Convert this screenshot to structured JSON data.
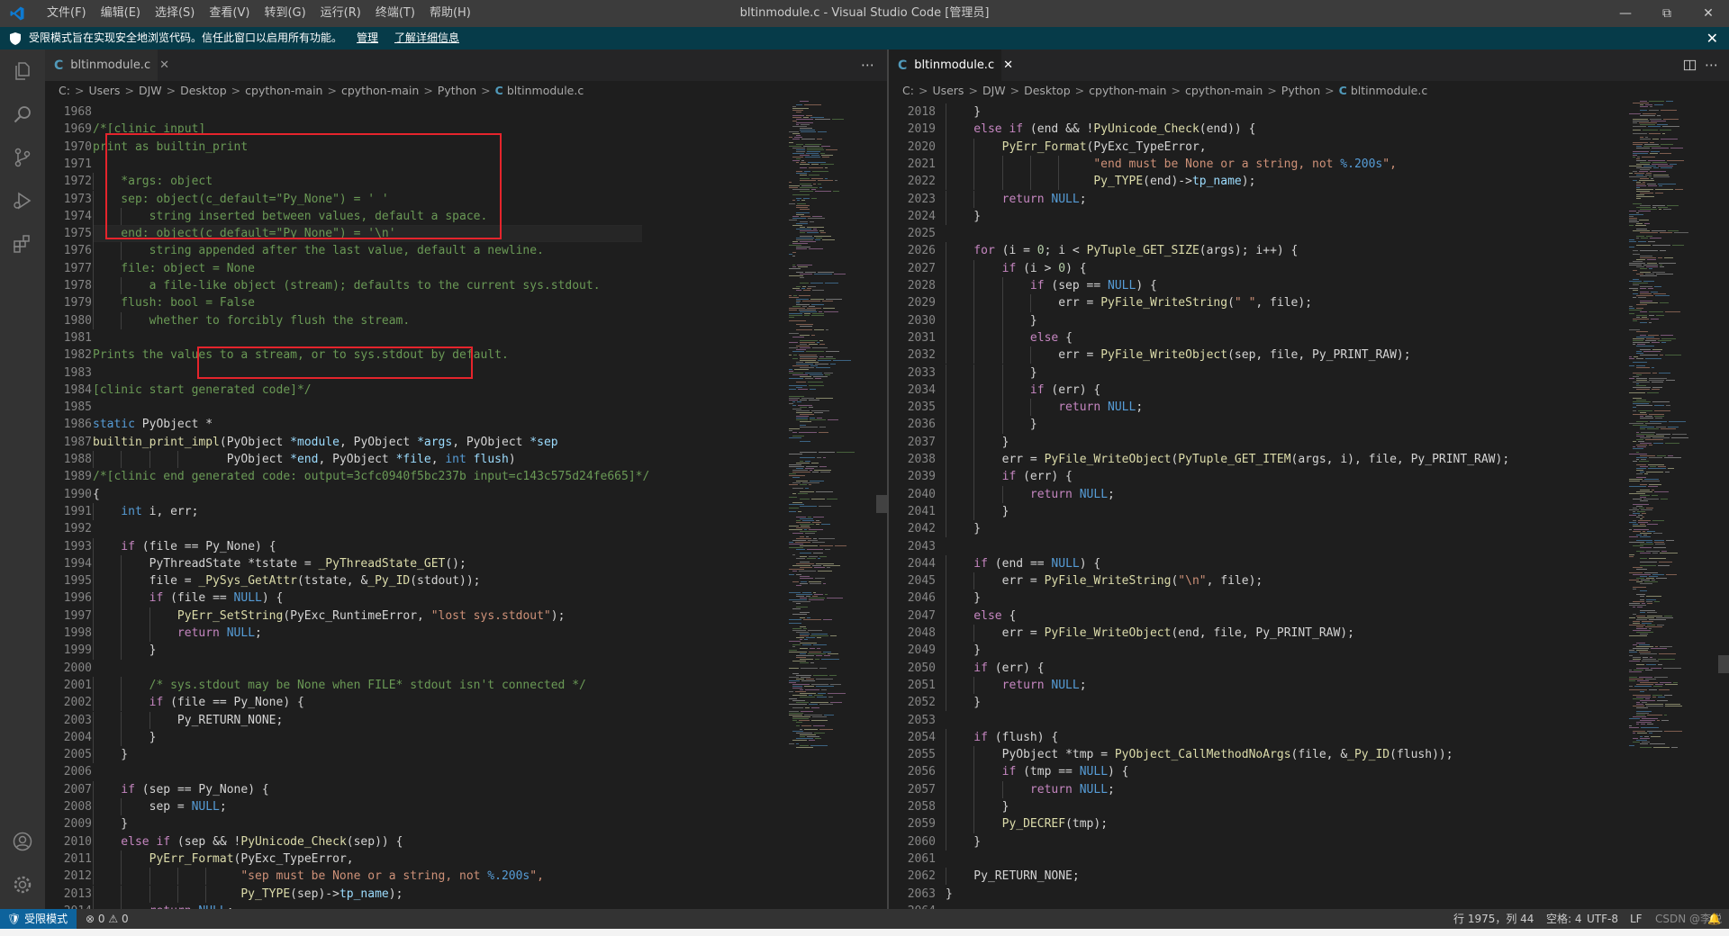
{
  "titlebar": {
    "menus": [
      "文件(F)",
      "编辑(E)",
      "选择(S)",
      "查看(V)",
      "转到(G)",
      "运行(R)",
      "终端(T)",
      "帮助(H)"
    ],
    "title": "bltinmodule.c - Visual Studio Code [管理员]"
  },
  "banner": {
    "message": "受限模式旨在实现安全地浏览代码。信任此窗口以启用所有功能。",
    "manage_link": "管理",
    "learn_link": "了解详细信息"
  },
  "activity": [
    "explorer-icon",
    "search-icon",
    "source-control-icon",
    "run-debug-icon",
    "extensions-icon",
    "accounts-icon",
    "settings-gear-icon"
  ],
  "editors": {
    "left": {
      "tab": "bltinmodule.c",
      "breadcrumb": [
        "C:",
        "Users",
        "DJW",
        "Desktop",
        "cpython-main",
        "cpython-main",
        "Python",
        "bltinmodule.c"
      ],
      "first_line": 1968,
      "lines": [
        [],
        [
          [
            "/*[clinic input]",
            "c"
          ]
        ],
        [
          [
            "print as builtin_print",
            "c"
          ]
        ],
        [],
        [
          [
            "    *args: object",
            "c"
          ]
        ],
        [
          [
            "    sep: object(c_default=\"Py_None\") = ' '",
            "c"
          ]
        ],
        [
          [
            "        string inserted between values, default a space.",
            "c"
          ]
        ],
        [
          [
            "    end: object(c_default=\"Py_None\") = '\\n'",
            "c"
          ]
        ],
        [
          [
            "        string appended after the last value, default a newline.",
            "c"
          ]
        ],
        [
          [
            "    file: object = None",
            "c"
          ]
        ],
        [
          [
            "        a file-like object (stream); defaults to the current sys.stdout.",
            "c"
          ]
        ],
        [
          [
            "    flush: bool = False",
            "c"
          ]
        ],
        [
          [
            "        whether to forcibly flush the stream.",
            "c"
          ]
        ],
        [],
        [
          [
            "Prints the values to a stream, or to sys.stdout by default.",
            "c"
          ]
        ],
        [],
        [
          [
            "[clinic start generated code]*/",
            "c"
          ]
        ],
        [],
        [
          [
            "static ",
            "k"
          ],
          [
            "PyObject ",
            "i"
          ],
          [
            "*",
            "o"
          ]
        ],
        [
          [
            "builtin_print_impl",
            "f"
          ],
          [
            "(PyObject ",
            "i"
          ],
          [
            "*module",
            "v"
          ],
          [
            ", PyObject ",
            "i"
          ],
          [
            "*args",
            "v"
          ],
          [
            ", PyObject ",
            "i"
          ],
          [
            "*sep",
            "v"
          ]
        ],
        [
          [
            "                   PyObject ",
            "i"
          ],
          [
            "*end",
            "v"
          ],
          [
            ", PyObject ",
            "i"
          ],
          [
            "*file",
            "v"
          ],
          [
            ", ",
            "i"
          ],
          [
            "int ",
            "k"
          ],
          [
            "flush",
            "v"
          ],
          [
            ")",
            "i"
          ]
        ],
        [
          [
            "/*[clinic end generated code: output=3cfc0940f5bc237b input=c143c575d24fe665]*/",
            "c"
          ]
        ],
        [
          [
            "{",
            "i"
          ]
        ],
        [
          [
            "    int ",
            "k"
          ],
          [
            "i, err;",
            "i"
          ]
        ],
        [],
        [
          [
            "    if ",
            "t"
          ],
          [
            "(file ",
            "i"
          ],
          [
            "== ",
            "o"
          ],
          [
            "Py_None) {",
            "i"
          ]
        ],
        [
          [
            "        PyThreadState ",
            "i"
          ],
          [
            "*",
            "o"
          ],
          [
            "tstate ",
            "i"
          ],
          [
            "= ",
            "o"
          ],
          [
            "_PyThreadState_GET",
            "f"
          ],
          [
            "();",
            "i"
          ]
        ],
        [
          [
            "        file ",
            "i"
          ],
          [
            "= ",
            "o"
          ],
          [
            "_PySys_GetAttr",
            "f"
          ],
          [
            "(tstate, ",
            "i"
          ],
          [
            "&",
            "o"
          ],
          [
            "_Py_ID",
            "f"
          ],
          [
            "(stdout));",
            "i"
          ]
        ],
        [
          [
            "        if ",
            "t"
          ],
          [
            "(file ",
            "i"
          ],
          [
            "== ",
            "o"
          ],
          [
            "NULL",
            "k"
          ],
          [
            ") {",
            "i"
          ]
        ],
        [
          [
            "            PyErr_SetString",
            "f"
          ],
          [
            "(PyExc_RuntimeError, ",
            "i"
          ],
          [
            "\"lost sys.stdout\"",
            "s"
          ],
          [
            ");",
            "i"
          ]
        ],
        [
          [
            "            return ",
            "t"
          ],
          [
            "NULL",
            "k"
          ],
          [
            ";",
            "i"
          ]
        ],
        [
          [
            "        }",
            "i"
          ]
        ],
        [],
        [
          [
            "        /* sys.stdout may be None when FILE* stdout isn't connected */",
            "c"
          ]
        ],
        [
          [
            "        if ",
            "t"
          ],
          [
            "(file ",
            "i"
          ],
          [
            "== ",
            "o"
          ],
          [
            "Py_None) {",
            "i"
          ]
        ],
        [
          [
            "            Py_RETURN_NONE;",
            "i"
          ]
        ],
        [
          [
            "        }",
            "i"
          ]
        ],
        [
          [
            "    }",
            "i"
          ]
        ],
        [],
        [
          [
            "    if ",
            "t"
          ],
          [
            "(sep ",
            "i"
          ],
          [
            "== ",
            "o"
          ],
          [
            "Py_None) {",
            "i"
          ]
        ],
        [
          [
            "        sep ",
            "i"
          ],
          [
            "= ",
            "o"
          ],
          [
            "NULL",
            "k"
          ],
          [
            ";",
            "i"
          ]
        ],
        [
          [
            "    }",
            "i"
          ]
        ],
        [
          [
            "    else if ",
            "t"
          ],
          [
            "(sep ",
            "i"
          ],
          [
            "&& !",
            "o"
          ],
          [
            "PyUnicode_Check",
            "f"
          ],
          [
            "(sep)) {",
            "i"
          ]
        ],
        [
          [
            "        PyErr_Format",
            "f"
          ],
          [
            "(PyExc_TypeError,",
            "i"
          ]
        ],
        [
          [
            "                     \"sep must be None or a string, not ",
            "s"
          ],
          [
            "%.200s",
            "k"
          ],
          [
            "\",",
            "s"
          ]
        ],
        [
          [
            "                     Py_TYPE",
            "f"
          ],
          [
            "(sep)->",
            "i"
          ],
          [
            "tp_name",
            "v"
          ],
          [
            ");",
            "i"
          ]
        ],
        [
          [
            "        return ",
            "t"
          ],
          [
            "NULL",
            "k"
          ],
          [
            ";",
            "i"
          ]
        ]
      ]
    },
    "right": {
      "tab": "bltinmodule.c",
      "breadcrumb": [
        "C:",
        "Users",
        "DJW",
        "Desktop",
        "cpython-main",
        "cpython-main",
        "Python",
        "bltinmodule.c"
      ],
      "first_line": 2018,
      "lines": [
        [
          [
            "    }",
            "i"
          ]
        ],
        [
          [
            "    else if ",
            "t"
          ],
          [
            "(end ",
            "i"
          ],
          [
            "&& !",
            "o"
          ],
          [
            "PyUnicode_Check",
            "f"
          ],
          [
            "(end)) {",
            "i"
          ]
        ],
        [
          [
            "        PyErr_Format",
            "f"
          ],
          [
            "(PyExc_TypeError,",
            "i"
          ]
        ],
        [
          [
            "                     \"end must be None or a string, not ",
            "s"
          ],
          [
            "%.200s",
            "k"
          ],
          [
            "\",",
            "s"
          ]
        ],
        [
          [
            "                     Py_TYPE",
            "f"
          ],
          [
            "(end)->",
            "i"
          ],
          [
            "tp_name",
            "v"
          ],
          [
            ");",
            "i"
          ]
        ],
        [
          [
            "        return ",
            "t"
          ],
          [
            "NULL",
            "k"
          ],
          [
            ";",
            "i"
          ]
        ],
        [
          [
            "    }",
            "i"
          ]
        ],
        [],
        [
          [
            "    for ",
            "t"
          ],
          [
            "(i ",
            "i"
          ],
          [
            "= ",
            "o"
          ],
          [
            "0",
            "n"
          ],
          [
            "; i ",
            "i"
          ],
          [
            "< ",
            "o"
          ],
          [
            "PyTuple_GET_SIZE",
            "f"
          ],
          [
            "(args); i",
            "i"
          ],
          [
            "++",
            "o"
          ],
          [
            ") {",
            "i"
          ]
        ],
        [
          [
            "        if ",
            "t"
          ],
          [
            "(i ",
            "i"
          ],
          [
            "> ",
            "o"
          ],
          [
            "0",
            "n"
          ],
          [
            ") {",
            "i"
          ]
        ],
        [
          [
            "            if ",
            "t"
          ],
          [
            "(sep ",
            "i"
          ],
          [
            "== ",
            "o"
          ],
          [
            "NULL",
            "k"
          ],
          [
            ") {",
            "i"
          ]
        ],
        [
          [
            "                err ",
            "i"
          ],
          [
            "= ",
            "o"
          ],
          [
            "PyFile_WriteString",
            "f"
          ],
          [
            "(",
            "i"
          ],
          [
            "\" \"",
            "s"
          ],
          [
            ", file);",
            "i"
          ]
        ],
        [
          [
            "            }",
            "i"
          ]
        ],
        [
          [
            "            else ",
            "t"
          ],
          [
            "{",
            "i"
          ]
        ],
        [
          [
            "                err ",
            "i"
          ],
          [
            "= ",
            "o"
          ],
          [
            "PyFile_WriteObject",
            "f"
          ],
          [
            "(sep, file, Py_PRINT_RAW);",
            "i"
          ]
        ],
        [
          [
            "            }",
            "i"
          ]
        ],
        [
          [
            "            if ",
            "t"
          ],
          [
            "(err) {",
            "i"
          ]
        ],
        [
          [
            "                return ",
            "t"
          ],
          [
            "NULL",
            "k"
          ],
          [
            ";",
            "i"
          ]
        ],
        [
          [
            "            }",
            "i"
          ]
        ],
        [
          [
            "        }",
            "i"
          ]
        ],
        [
          [
            "        err ",
            "i"
          ],
          [
            "= ",
            "o"
          ],
          [
            "PyFile_WriteObject",
            "f"
          ],
          [
            "(",
            "i"
          ],
          [
            "PyTuple_GET_ITEM",
            "f"
          ],
          [
            "(args, i), file, Py_PRINT_RAW);",
            "i"
          ]
        ],
        [
          [
            "        if ",
            "t"
          ],
          [
            "(err) {",
            "i"
          ]
        ],
        [
          [
            "            return ",
            "t"
          ],
          [
            "NULL",
            "k"
          ],
          [
            ";",
            "i"
          ]
        ],
        [
          [
            "        }",
            "i"
          ]
        ],
        [
          [
            "    }",
            "i"
          ]
        ],
        [],
        [
          [
            "    if ",
            "t"
          ],
          [
            "(end ",
            "i"
          ],
          [
            "== ",
            "o"
          ],
          [
            "NULL",
            "k"
          ],
          [
            ") {",
            "i"
          ]
        ],
        [
          [
            "        err ",
            "i"
          ],
          [
            "= ",
            "o"
          ],
          [
            "PyFile_WriteString",
            "f"
          ],
          [
            "(",
            "i"
          ],
          [
            "\"\\n\"",
            "s"
          ],
          [
            ", file);",
            "i"
          ]
        ],
        [
          [
            "    }",
            "i"
          ]
        ],
        [
          [
            "    else ",
            "t"
          ],
          [
            "{",
            "i"
          ]
        ],
        [
          [
            "        err ",
            "i"
          ],
          [
            "= ",
            "o"
          ],
          [
            "PyFile_WriteObject",
            "f"
          ],
          [
            "(end, file, Py_PRINT_RAW);",
            "i"
          ]
        ],
        [
          [
            "    }",
            "i"
          ]
        ],
        [
          [
            "    if ",
            "t"
          ],
          [
            "(err) {",
            "i"
          ]
        ],
        [
          [
            "        return ",
            "t"
          ],
          [
            "NULL",
            "k"
          ],
          [
            ";",
            "i"
          ]
        ],
        [
          [
            "    }",
            "i"
          ]
        ],
        [],
        [
          [
            "    if ",
            "t"
          ],
          [
            "(flush) {",
            "i"
          ]
        ],
        [
          [
            "        PyObject ",
            "i"
          ],
          [
            "*",
            "o"
          ],
          [
            "tmp ",
            "i"
          ],
          [
            "= ",
            "o"
          ],
          [
            "PyObject_CallMethodNoArgs",
            "f"
          ],
          [
            "(file, ",
            "i"
          ],
          [
            "&",
            "o"
          ],
          [
            "_Py_ID",
            "f"
          ],
          [
            "(flush));",
            "i"
          ]
        ],
        [
          [
            "        if ",
            "t"
          ],
          [
            "(tmp ",
            "i"
          ],
          [
            "== ",
            "o"
          ],
          [
            "NULL",
            "k"
          ],
          [
            ") {",
            "i"
          ]
        ],
        [
          [
            "            return ",
            "t"
          ],
          [
            "NULL",
            "k"
          ],
          [
            ";",
            "i"
          ]
        ],
        [
          [
            "        }",
            "i"
          ]
        ],
        [
          [
            "        Py_DECREF",
            "f"
          ],
          [
            "(tmp);",
            "i"
          ]
        ],
        [
          [
            "    }",
            "i"
          ]
        ],
        [],
        [
          [
            "    Py_RETURN_NONE;",
            "i"
          ]
        ],
        [
          [
            "}",
            "i"
          ]
        ],
        []
      ]
    }
  },
  "statusbar": {
    "restricted": "受限模式",
    "errors": "0",
    "warnings": "0",
    "position": "行 1975，列 44",
    "spaces": "空格: 4",
    "encoding": "UTF-8",
    "eol": "LF",
    "watermark": "CSDN @李锐"
  },
  "colors": {
    "keyword": "#569cd6",
    "control": "#c586c0",
    "function": "#dcdcaa",
    "string": "#ce9178",
    "comment": "#6a9955",
    "variable": "#9cdcfe",
    "number": "#b5cea8",
    "highlight_box": "#e5242c"
  }
}
